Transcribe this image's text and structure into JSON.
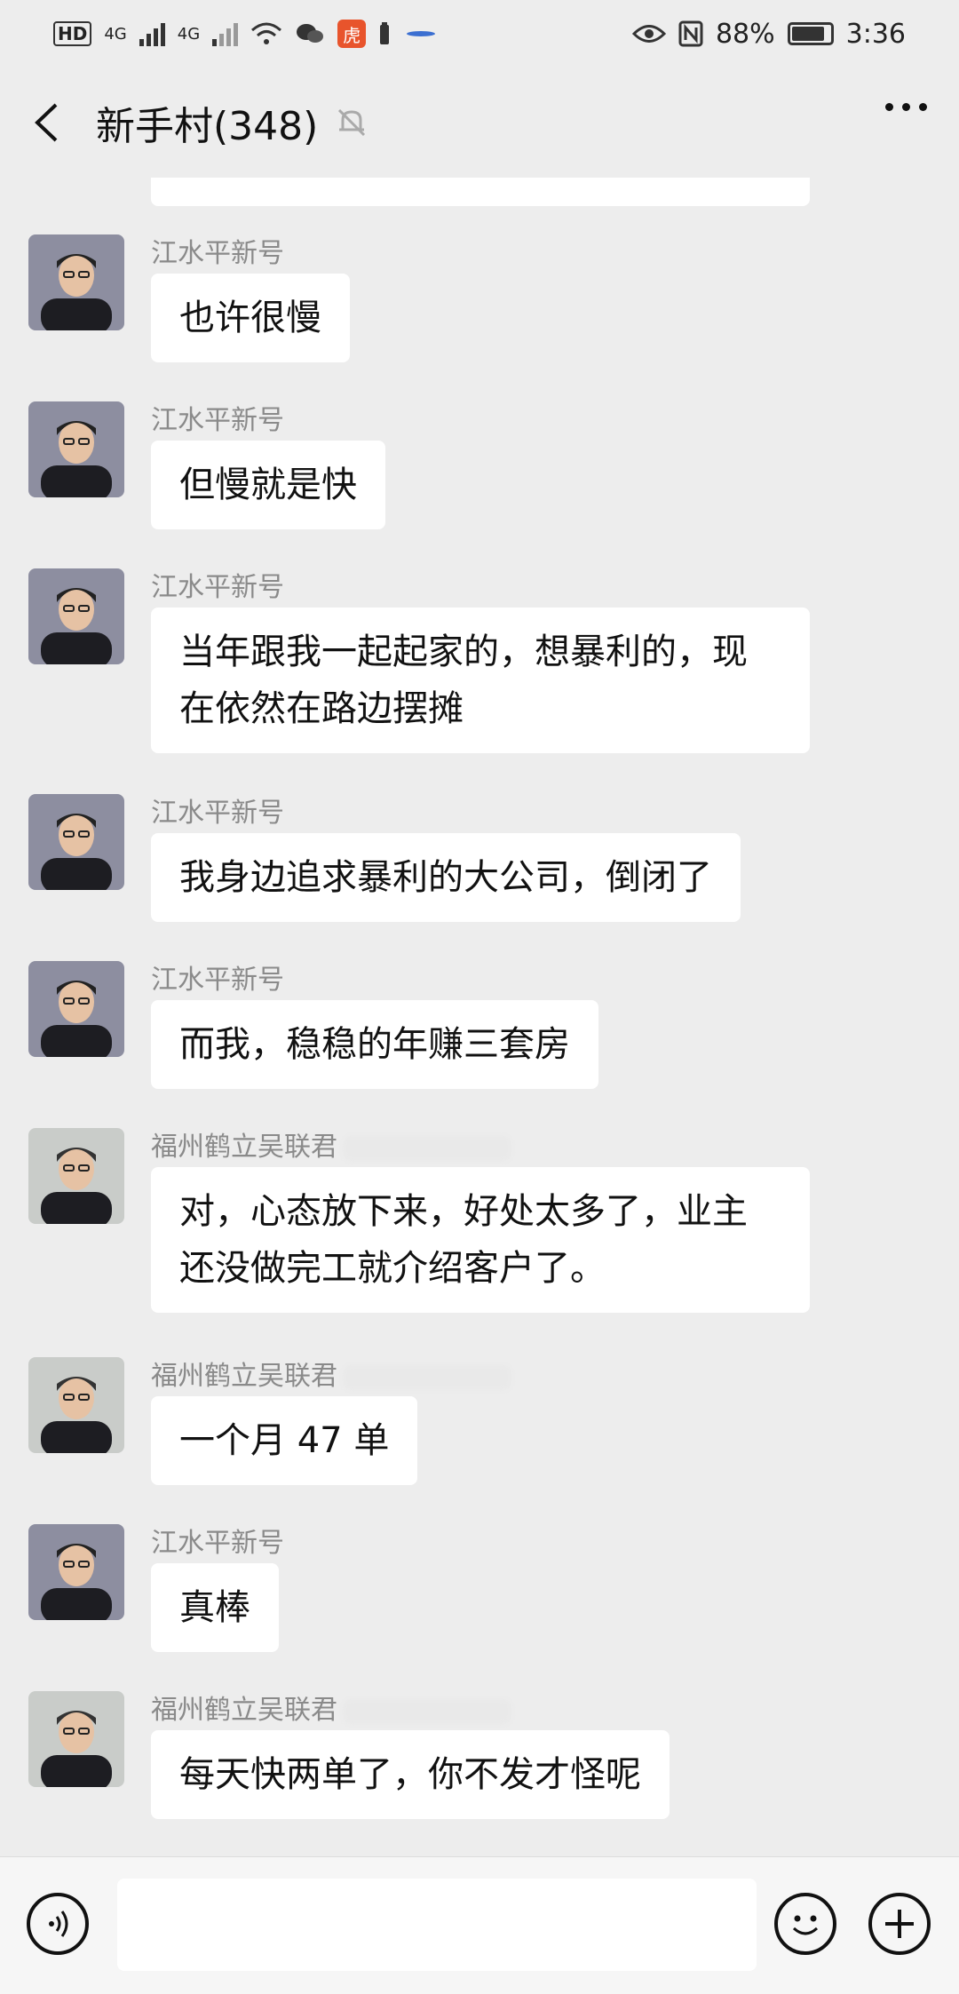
{
  "status_bar": {
    "hd": "HD",
    "net1": "4G",
    "net2": "4G",
    "app_badge": "虎",
    "battery": "88%",
    "time": "3:36"
  },
  "header": {
    "title": "新手村(348)"
  },
  "messages": [
    {
      "sender": "江水平新号",
      "text": "也许很慢",
      "avatar": "jiang"
    },
    {
      "sender": "江水平新号",
      "text": "但慢就是快",
      "avatar": "jiang"
    },
    {
      "sender": "江水平新号",
      "text": "当年跟我一起起家的，想暴利的，现在依然在路边摆摊",
      "avatar": "jiang"
    },
    {
      "sender": "江水平新号",
      "text": "我身边追求暴利的大公司，倒闭了",
      "avatar": "jiang"
    },
    {
      "sender": "江水平新号",
      "text": "而我，稳稳的年赚三套房",
      "avatar": "jiang"
    },
    {
      "sender": "福州鹤立吴联君",
      "text": "对，心态放下来，好处太多了，业主还没做完工就介绍客户了。",
      "avatar": "wu"
    },
    {
      "sender": "福州鹤立吴联君",
      "text": "一个月 47 单",
      "avatar": "wu"
    },
    {
      "sender": "江水平新号",
      "text": "真棒",
      "avatar": "jiang"
    },
    {
      "sender": "福州鹤立吴联君",
      "text": "每天快两单了，你不发才怪呢",
      "avatar": "wu"
    }
  ],
  "colors": {
    "background": "#ededed",
    "bubble": "#ffffff",
    "sender": "#8a8a8a"
  }
}
